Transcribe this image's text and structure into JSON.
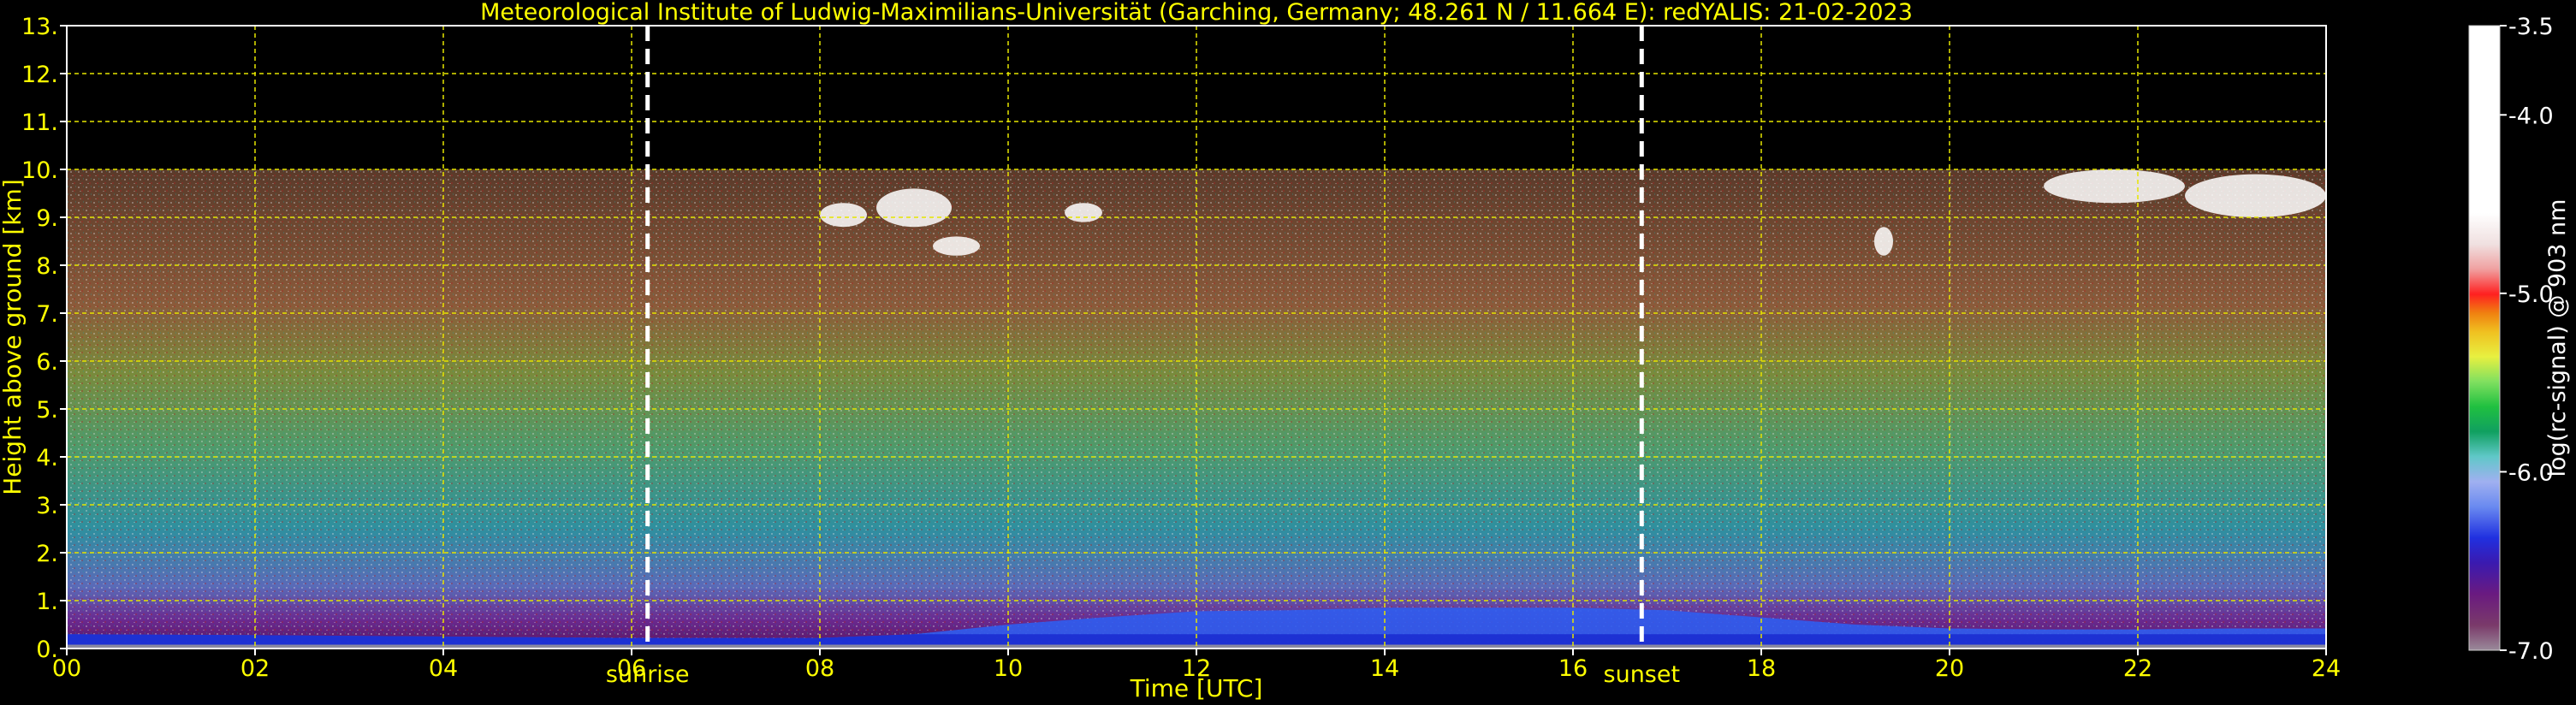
{
  "chart_data": {
    "type": "heatmap",
    "title": "Meteorological Institute of Ludwig-Maximilians-Universität (Garching, Germany; 48.261 N / 11.664 E):    redYALIS: 21-02-2023",
    "xlabel": "Time [UTC]",
    "ylabel": "Height above ground [km]",
    "xlim": [
      0,
      24
    ],
    "ylim": [
      0,
      13
    ],
    "x_ticks": [
      "00",
      "02",
      "04",
      "06",
      "08",
      "10",
      "12",
      "14",
      "16",
      "18",
      "20",
      "22",
      "24"
    ],
    "y_ticks": [
      "0.",
      "1.",
      "2.",
      "3.",
      "4.",
      "5.",
      "6.",
      "7.",
      "8.",
      "9.",
      "10.",
      "11.",
      "12.",
      "13."
    ],
    "grid": true,
    "data_top_km": 10,
    "annotations": [
      {
        "label": "sunrise",
        "time_utc": 6.17
      },
      {
        "label": "sunset",
        "time_utc": 16.73
      }
    ],
    "colorbar": {
      "label": "log(rc-signal) @ 903 nm",
      "range": [
        -7.0,
        -3.5
      ],
      "ticks": [
        "-3.5",
        "-4.0",
        "-5.0",
        "-6.0",
        "-7.0"
      ],
      "tick_values": [
        -3.5,
        -4.0,
        -5.0,
        -6.0,
        -7.0
      ]
    },
    "boundary_layer_top_km": {
      "x": [
        0,
        2,
        4,
        6,
        8,
        9,
        10,
        11,
        12,
        13,
        14,
        15,
        16,
        17,
        18,
        19,
        20,
        21,
        22,
        23,
        24
      ],
      "values": [
        0.3,
        0.28,
        0.25,
        0.22,
        0.22,
        0.3,
        0.5,
        0.65,
        0.78,
        0.8,
        0.85,
        0.85,
        0.85,
        0.8,
        0.65,
        0.5,
        0.42,
        0.4,
        0.4,
        0.42,
        0.42
      ]
    },
    "cloud_patches": [
      {
        "t_start": 8.0,
        "t_end": 8.5,
        "z_bottom": 8.8,
        "z_top": 9.3
      },
      {
        "t_start": 8.6,
        "t_end": 9.4,
        "z_bottom": 8.8,
        "z_top": 9.6
      },
      {
        "t_start": 9.2,
        "t_end": 9.7,
        "z_bottom": 8.2,
        "z_top": 8.6
      },
      {
        "t_start": 10.6,
        "t_end": 11.0,
        "z_bottom": 8.9,
        "z_top": 9.3
      },
      {
        "t_start": 19.2,
        "t_end": 19.4,
        "z_bottom": 8.2,
        "z_top": 8.8
      },
      {
        "t_start": 21.0,
        "t_end": 22.5,
        "z_bottom": 9.3,
        "z_top": 10.0
      },
      {
        "t_start": 22.5,
        "t_end": 24.0,
        "z_bottom": 9.0,
        "z_top": 9.9
      }
    ]
  }
}
